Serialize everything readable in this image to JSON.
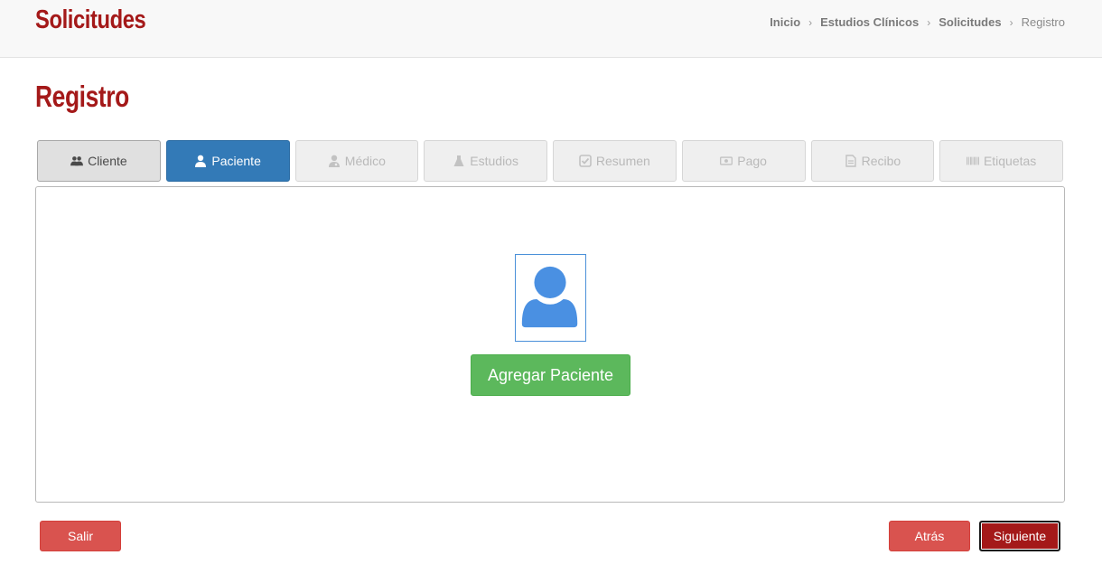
{
  "header": {
    "title": "Solicitudes",
    "breadcrumb": [
      "Inicio",
      "Estudios Clínicos",
      "Solicitudes",
      "Registro"
    ]
  },
  "page": {
    "title": "Registro"
  },
  "tabs": [
    {
      "label": "Cliente",
      "icon": "users-icon",
      "state": "done"
    },
    {
      "label": "Paciente",
      "icon": "user-icon",
      "state": "active"
    },
    {
      "label": "Médico",
      "icon": "user-md-icon",
      "state": "disabled"
    },
    {
      "label": "Estudios",
      "icon": "flask-icon",
      "state": "disabled"
    },
    {
      "label": "Resumen",
      "icon": "check-square-icon",
      "state": "disabled"
    },
    {
      "label": "Pago",
      "icon": "money-icon",
      "state": "disabled"
    },
    {
      "label": "Recibo",
      "icon": "file-text-icon",
      "state": "disabled"
    },
    {
      "label": "Etiquetas",
      "icon": "barcode-icon",
      "state": "disabled"
    }
  ],
  "panel": {
    "avatar_icon": "user-avatar-icon",
    "add_button_label": "Agregar Paciente"
  },
  "footer": {
    "exit_label": "Salir",
    "back_label": "Atrás",
    "next_label": "Siguiente"
  },
  "colors": {
    "brand_red": "#a41919",
    "active_blue": "#337ab7",
    "success_green": "#5cb85c",
    "danger_red": "#d9534f",
    "avatar_blue": "#4a90e2"
  }
}
